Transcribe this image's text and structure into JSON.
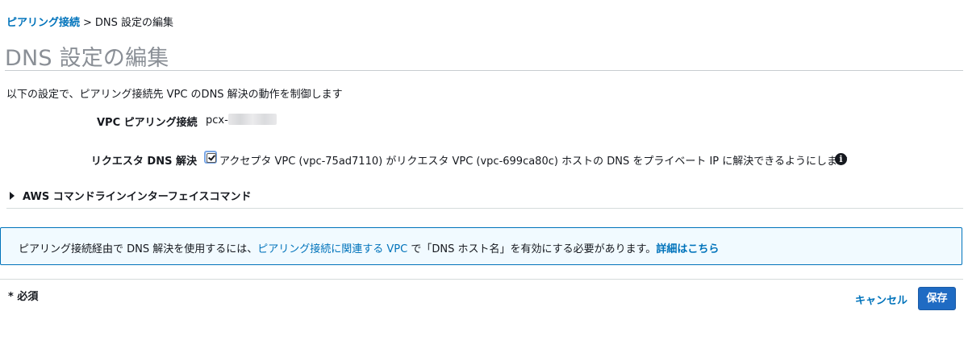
{
  "breadcrumb": {
    "parent_label": "ピアリング接続",
    "separator": ">",
    "current_label": "DNS 設定の編集"
  },
  "page": {
    "title": "DNS 設定の編集",
    "description": "以下の設定で、ピアリング接続先 VPC のDNS 解決の動作を制御します"
  },
  "form": {
    "peering_connection": {
      "label": "VPC ピアリング接続",
      "value_prefix": "pcx-"
    },
    "requester_dns": {
      "label": "リクエスタ DNS 解決",
      "checked": true,
      "checkbox_label": "アクセプタ VPC (vpc-75ad7110) がリクエスタ VPC (vpc-699ca80c) ホストの DNS をプライベート IP に解決できるようにします",
      "info_icon": "info-icon"
    }
  },
  "cli_section": {
    "label": "AWS コマンドラインインターフェイスコマンド",
    "expanded": false,
    "icon": "caret-right-icon"
  },
  "alert": {
    "text_before": "ピアリング接続経由で DNS 解決を使用するには、",
    "link_text": "ピアリング接続に関連する VPC",
    "text_after": " で「DNS ホスト名」を有効にする必要があります。",
    "learn_more": "詳細はこちら"
  },
  "footer": {
    "required_note": "* 必須",
    "cancel_label": "キャンセル",
    "save_label": "保存"
  },
  "colors": {
    "link": "#0073bb",
    "primary_button": "#1f6bc3",
    "alert_border": "#0073bb",
    "alert_background": "#f1faff"
  }
}
